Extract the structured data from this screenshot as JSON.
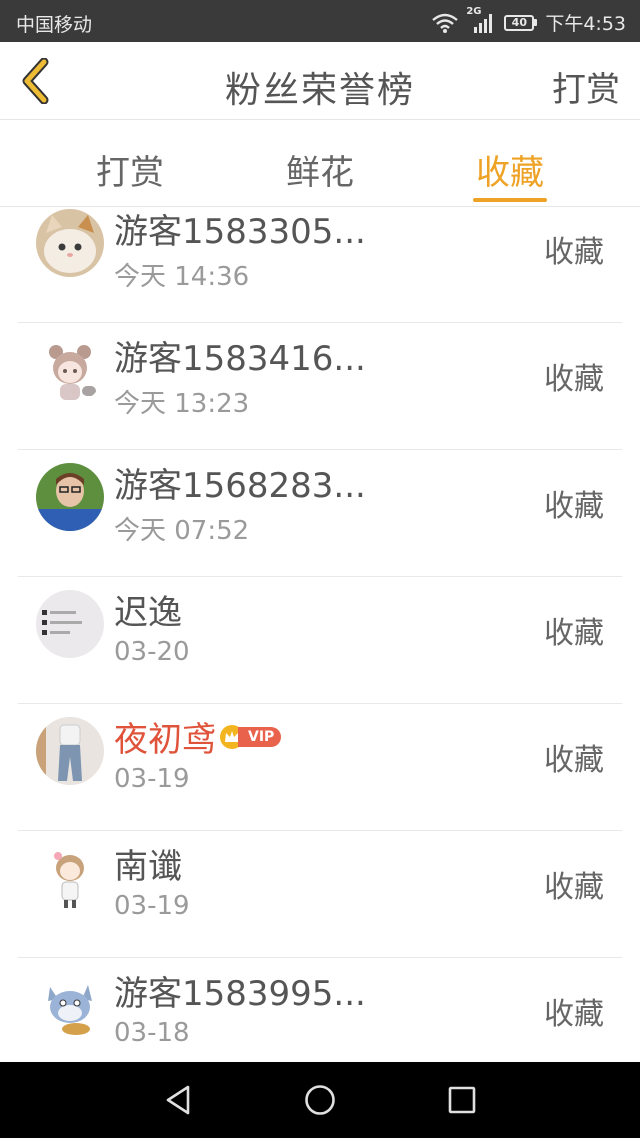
{
  "status_bar": {
    "carrier": "中国移动",
    "network": "2G",
    "battery": "40",
    "time": "下午4:53"
  },
  "header": {
    "title": "粉丝荣誉榜",
    "action": "打赏"
  },
  "tabs": [
    {
      "label": "打赏",
      "active": false
    },
    {
      "label": "鲜花",
      "active": false
    },
    {
      "label": "收藏",
      "active": true
    }
  ],
  "accent_color": "#eea326",
  "vip_name_color": "#e0533b",
  "list": [
    {
      "name": "游客1583305...",
      "time": "今天 14:36",
      "action": "收藏"
    },
    {
      "name": "游客1583416...",
      "time": "今天 13:23",
      "action": "收藏"
    },
    {
      "name": "游客1568283...",
      "time": "今天 07:52",
      "action": "收藏"
    },
    {
      "name": "迟逸",
      "time": "03-20",
      "action": "收藏"
    },
    {
      "name": "夜初鸢",
      "time": "03-19",
      "action": "收藏",
      "vip_label": "VIP"
    },
    {
      "name": "南谶",
      "time": "03-19",
      "action": "收藏"
    },
    {
      "name": "游客1583995...",
      "time": "03-18",
      "action": "收藏"
    }
  ],
  "icons": {
    "back": "chevron-left-icon",
    "nav_back": "triangle-back-icon",
    "nav_home": "circle-home-icon",
    "nav_recent": "square-recent-icon"
  }
}
